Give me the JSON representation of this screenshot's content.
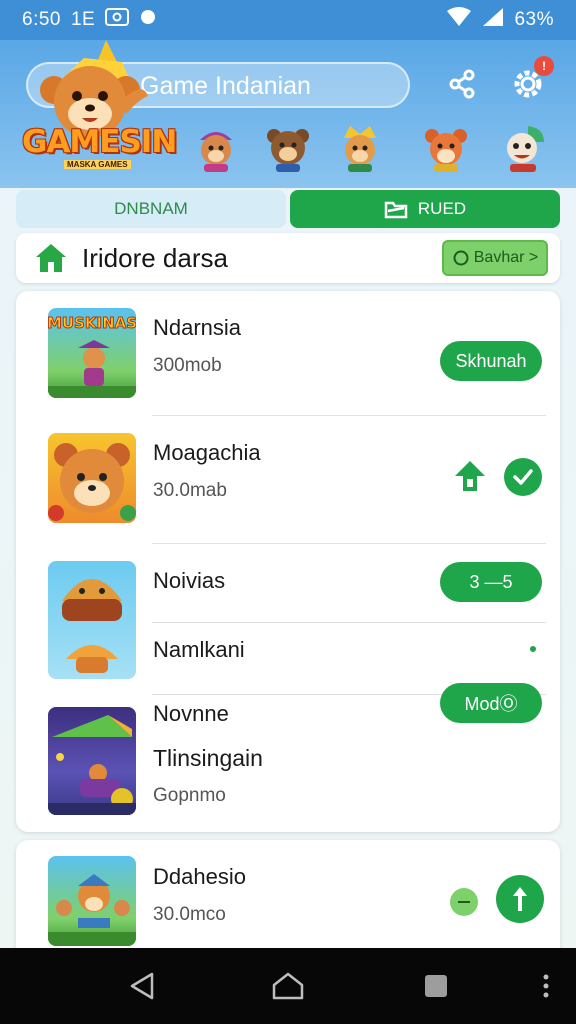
{
  "status_bar": {
    "time": "6:50",
    "carrier": "1E",
    "battery": "63%"
  },
  "header": {
    "search_text": "Game Indanian",
    "logo_text": "GAMESIN",
    "logo_subtitle": "MASKA GAMES",
    "notification_count": "!",
    "icons": [
      "share-icon",
      "settings-icon"
    ]
  },
  "tabs": [
    {
      "label": "DNBNAM",
      "active": false
    },
    {
      "label": "RUED",
      "active": true
    }
  ],
  "section": {
    "title": "Iridore darsa",
    "browse_label": "Bavhar >"
  },
  "games": [
    {
      "name": "Ndarnsia",
      "size": "300mob",
      "action_label": "Skhunah"
    },
    {
      "name": "Moagachia",
      "size": "30.0mab"
    },
    {
      "name": "Noivias",
      "action_label": "3 —5"
    },
    {
      "name": "Namlkani"
    },
    {
      "name": "Novnne",
      "subtitle": "Tlinsingain",
      "size": "Gopnmo",
      "action_label": "ModⓄ"
    },
    {
      "name": "Ddahesio",
      "size": "30.0mco"
    }
  ],
  "thumb_labels": {
    "first": "MUSKINAS"
  },
  "colors": {
    "accent_green": "#1fa54a",
    "header_blue": "#59a7e6",
    "status_blue": "#3f8fd6"
  }
}
